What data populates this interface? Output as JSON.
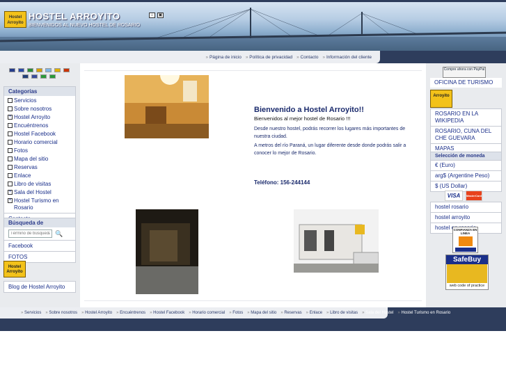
{
  "header": {
    "logo_text": "Hostel Arroyito",
    "title": "HOSTEL ARROYITO",
    "subtitle": "BIENVENIDOS AL NUEVO HOSTEL DE ROSARIO",
    "icons": [
      "home-icon",
      "bookmark-icon"
    ]
  },
  "top_nav": [
    "Página de inicio",
    "Política de privacidad",
    "Contacto",
    "Información del cliente"
  ],
  "flags": [
    {
      "name": "english",
      "color": "#243c8c"
    },
    {
      "name": "french",
      "color": "#2a4ba8"
    },
    {
      "name": "portuguese",
      "color": "#2c8a3a"
    },
    {
      "name": "spanish",
      "color": "#d8a000"
    },
    {
      "name": "argentina",
      "color": "#7fb6e6"
    },
    {
      "name": "germany",
      "color": "#e0b000"
    },
    {
      "name": "netherlands",
      "color": "#cc3300"
    },
    {
      "name": "australia",
      "color": "#23407a"
    },
    {
      "name": "usa",
      "color": "#3a4c9c"
    },
    {
      "name": "italy",
      "color": "#2c9a3a"
    },
    {
      "name": "brazil",
      "color": "#2a9a3a"
    }
  ],
  "categories": {
    "title": "Categorías",
    "items": [
      {
        "label": "Servicios",
        "expand": false
      },
      {
        "label": "Sobre nosotros",
        "expand": false
      },
      {
        "label": "Hostel Arroyito",
        "expand": true
      },
      {
        "label": "Encuéntrenos",
        "expand": false
      },
      {
        "label": "Hostel Facebook",
        "expand": false
      },
      {
        "label": "Horario comercial",
        "expand": false
      },
      {
        "label": "Fotos",
        "expand": false
      },
      {
        "label": "Mapa del sitio",
        "expand": false
      },
      {
        "label": "Reservas",
        "expand": false
      },
      {
        "label": "Enlace",
        "expand": false
      },
      {
        "label": "Libro de visitas",
        "expand": false
      },
      {
        "label": "Sala del Hostel",
        "expand": true
      },
      {
        "label": "Hostel Turismo en Rosario",
        "expand": true
      }
    ],
    "contact": "Contacto"
  },
  "search": {
    "title": "Búsqueda de",
    "placeholder": "Término de búsqueda",
    "links": [
      "Facebook",
      "FOTOS"
    ]
  },
  "blog_link": "Blog de Hostel Arroyito",
  "main": {
    "welcome_title": "Bienvenido a Hostel Arroyito!!",
    "welcome_sub": "Bienvenidos al mejor hostel de Rosario !!!",
    "paragraph1": "Desde nuestro hostel, podrás recorrer los lugares más importantes de nuestra ciudad.",
    "paragraph2": "A metros del río Paraná, un lugar diferente desde donde podrás salir a conocer lo mejor de Rosario.",
    "phone": "Teléfono: 156-244144"
  },
  "right": {
    "paypal": "Compre ahora con PayPal",
    "oficina": "OFICINA DE TURISMO",
    "links": [
      "ROSARIO EN LA WIKIPEDIA",
      "ROSARIO, CUNA DEL CHE GUEVARA",
      "MAPAS"
    ],
    "currency_title": "Selección de moneda",
    "currencies": [
      "€ (Euro)",
      "arg$ (Argentine Peso)",
      "$ (US Dollar)"
    ],
    "cards": [
      "VISA",
      "MasterCard"
    ],
    "tags": [
      "hostel rosario",
      "hostel arroyito",
      "hostel en rosario"
    ],
    "confianza": "CONFIANZA EN LINEA",
    "safebuy_title": "SafeBuy",
    "safebuy_sub": "web code of practice"
  },
  "footer_nav": [
    "Servicios",
    "Sobre nosotros",
    "Hostel Arroyito",
    "Encuéntrenos",
    "Hostel Facebook",
    "Horario comercial",
    "Fotos",
    "Mapa del sitio",
    "Reservas",
    "Enlace",
    "Libro de visitas",
    "Sala del Hostel",
    "Hostel Turismo en Rosario"
  ]
}
